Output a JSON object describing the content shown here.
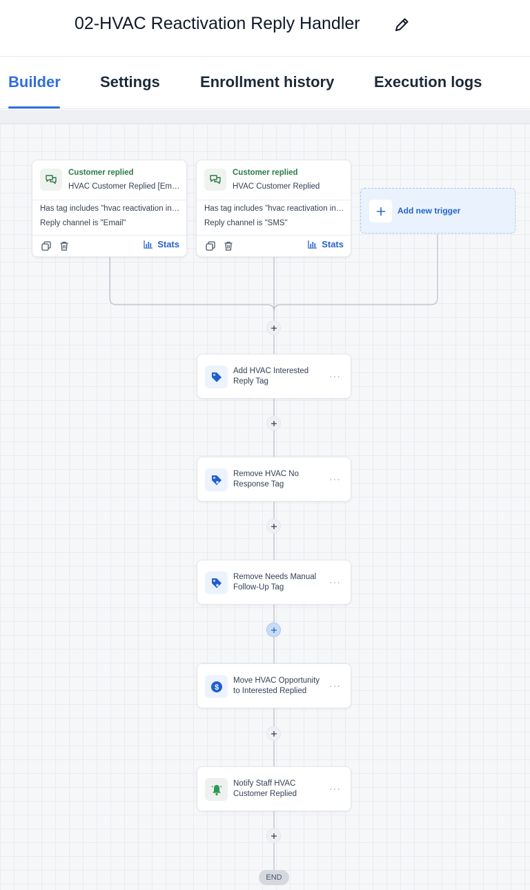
{
  "header": {
    "title": "02-HVAC Reactivation Reply Handler",
    "edit_icon": "pencil-icon"
  },
  "tabs": [
    {
      "label": "Builder",
      "active": true
    },
    {
      "label": "Settings",
      "active": false
    },
    {
      "label": "Enrollment history",
      "active": false
    },
    {
      "label": "Execution logs",
      "active": false
    }
  ],
  "triggers": [
    {
      "type": "Customer replied",
      "name": "HVAC Customer Replied [Email]",
      "conditions": [
        "Has tag includes \"hvac reactivation interested\"",
        "Reply channel is \"Email\""
      ],
      "stats_label": "Stats",
      "icon": "chat-bubbles-icon"
    },
    {
      "type": "Customer replied",
      "name": "HVAC Customer Replied",
      "conditions": [
        "Has tag includes \"hvac reactivation interested\"",
        "Reply channel is \"SMS\""
      ],
      "stats_label": "Stats",
      "icon": "chat-bubbles-icon"
    }
  ],
  "add_trigger": {
    "label": "Add new trigger"
  },
  "actions": [
    {
      "label": "Add HVAC Interested Reply Tag",
      "icon": "tag-icon"
    },
    {
      "label": "Remove HVAC No Response Tag",
      "icon": "tag-remove-icon"
    },
    {
      "label": "Remove Needs Manual Follow-Up Tag",
      "icon": "tag-remove-icon"
    },
    {
      "label": "Move HVAC Opportunity to Interested Replied",
      "icon": "dollar-icon"
    },
    {
      "label": "Notify Staff HVAC Customer Replied",
      "icon": "bell-icon"
    }
  ],
  "more_label": "···",
  "end_label": "END",
  "colors": {
    "accent": "#2f6fde",
    "trigger_green": "#2c7a46"
  }
}
